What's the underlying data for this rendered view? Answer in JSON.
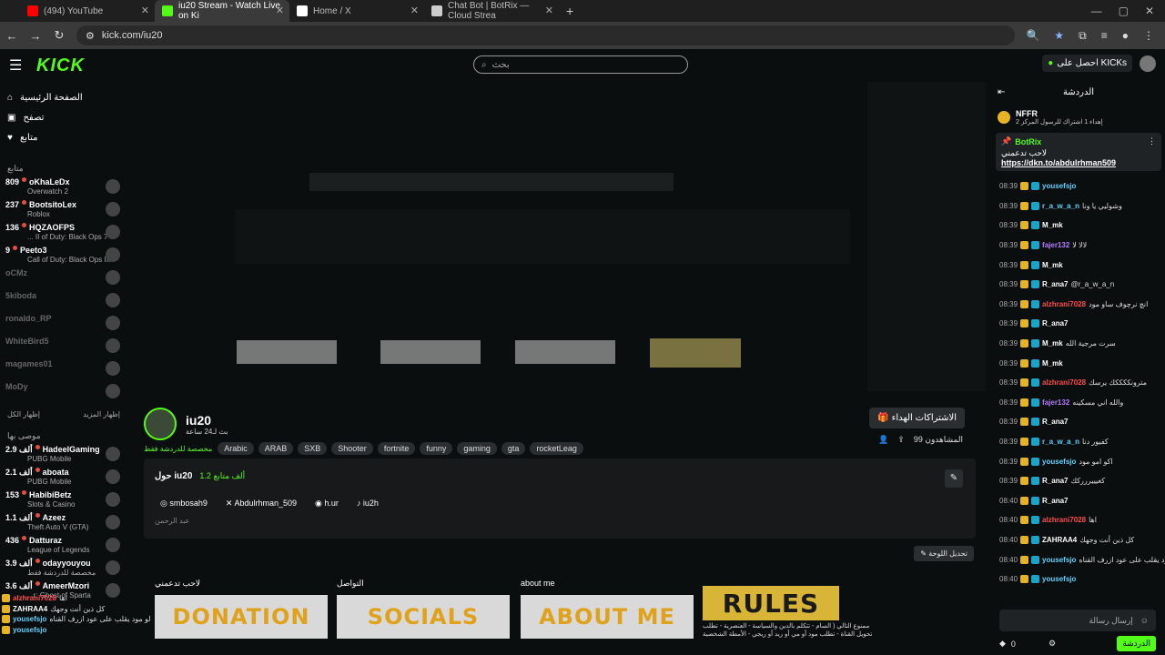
{
  "browser": {
    "tabs": [
      {
        "label": "(494) YouTube",
        "color": "#ff0000"
      },
      {
        "label": "iu20 Stream - Watch Live on Ki",
        "color": "#53fc18"
      },
      {
        "label": "Home / X",
        "color": "#ffffff"
      },
      {
        "label": "Chat Bot | BotRix — Cloud Strea",
        "color": "#cccccc"
      }
    ],
    "url": "kick.com/iu20"
  },
  "header": {
    "logo": "KICK",
    "search_placeholder": "بحث",
    "login_label": "احصل على KICKs"
  },
  "sidebar": {
    "nav": [
      {
        "label": "الصفحة الرئيسية",
        "icon": "home-icon"
      },
      {
        "label": "تصفح",
        "icon": "browse-icon"
      },
      {
        "label": "متابع",
        "icon": "heart-icon"
      }
    ],
    "followed_heading": "متابع",
    "followed": [
      {
        "count": "809",
        "name": "oKhaLeDx",
        "game": "Overwatch 2"
      },
      {
        "count": "237",
        "name": "BootsitoLex",
        "game": "Roblox"
      },
      {
        "count": "136",
        "name": "HQZAOFPS",
        "game": "... II of Duty: Black Ops 7"
      },
      {
        "count": "9",
        "name": "Peeto3",
        "game": "Call of Duty: Black Ops III"
      },
      {
        "count": "",
        "name": "oCMz",
        "game": ""
      },
      {
        "count": "",
        "name": "5kiboda",
        "game": ""
      },
      {
        "count": "",
        "name": "ronaldo_RP",
        "game": ""
      },
      {
        "count": "",
        "name": "WhiteBird5",
        "game": ""
      },
      {
        "count": "",
        "name": "magames01",
        "game": ""
      },
      {
        "count": "",
        "name": "MoDy",
        "game": ""
      }
    ],
    "show_more": "إظهار المزيد",
    "show_all": "إظهار الكل",
    "recommended_heading": "موصى بها",
    "recommended": [
      {
        "count": "2.9 ألف",
        "name": "HadeelGaming",
        "game": "PUBG Mobile"
      },
      {
        "count": "2.1 ألف",
        "name": "aboata",
        "game": "PUBG Mobile"
      },
      {
        "count": "153",
        "name": "HabibiBetz",
        "game": "Slots & Casino"
      },
      {
        "count": "1.1 ألف",
        "name": "Azeez",
        "game": "Theft Auto V (GTA)"
      },
      {
        "count": "436",
        "name": "Datturaz",
        "game": "League of Legends"
      },
      {
        "count": "3.9 ألف",
        "name": "odayyouyou",
        "game": "مخصصة للدردشة فقط"
      },
      {
        "count": "3.6 ألف",
        "name": "AmeerMzori",
        "game": "...r: Ghost of Sparta"
      }
    ]
  },
  "streamer": {
    "name": "iu20",
    "live_info": "بث لـ24 ساعة",
    "category": "مخصصة للدردشة فقط",
    "tags": [
      "Arabic",
      "ARAB",
      "SXB",
      "Shooter",
      "fortnite",
      "funny",
      "gaming",
      "gta",
      "rocketLeag"
    ],
    "subscribe_label": "الاشتراكات الهداء",
    "viewers": "99 المشاهدون"
  },
  "about": {
    "title": "حول iu20",
    "followers": "1.2 ألف متابع",
    "socials": [
      "smbosah9",
      "Abdulrhman_509",
      "h.ur",
      "iu2h"
    ],
    "bio": "عبد الرحمن",
    "edit_panels": "تحديل اللوحة"
  },
  "panels": [
    {
      "label": "لاحب تدعمني",
      "title": "DONATION"
    },
    {
      "label": "التواصل",
      "title": "SOCIALS"
    },
    {
      "label": "about me",
      "title": "ABOUT ME"
    },
    {
      "label": "",
      "title": "RULES"
    }
  ],
  "rules_text": "ممنوع التالي ( السام - تتكلم بالدين والسياسة - العنصرية - تطلب تحويل القناة - تطلب مود أو مي أو ريد أو ريجي - الأمطة الشخصية",
  "chat": {
    "title": "الدردشة",
    "top_gifter": "NFFR",
    "top_gifter_note": "إهداء 1 اشتراك للرسول المركز 2",
    "pinned_user": "BotRix",
    "pinned_text": "لاحب تدعمني",
    "pinned_link": "https://dkn.to/abdulrhman509",
    "messages": [
      {
        "time": "08:39",
        "user": "yousefsjo",
        "color": "#5fd3ff",
        "text": ""
      },
      {
        "time": "08:39",
        "user": "r_a_w_a_n",
        "color": "#5fd3ff",
        "text": "وشوليي يا ونا"
      },
      {
        "time": "08:39",
        "user": "M_mk",
        "color": "#ffffff",
        "text": ""
      },
      {
        "time": "08:39",
        "user": "fajer132",
        "color": "#b57aff",
        "text": "لالا لا"
      },
      {
        "time": "08:39",
        "user": "M_mk",
        "color": "#ffffff",
        "text": ""
      },
      {
        "time": "08:39",
        "user": "R_ana7",
        "color": "#ffffff",
        "text": "@r_a_w_a_n"
      },
      {
        "time": "08:39",
        "user": "alzhrani7028",
        "color": "#ff4b4b",
        "text": "انچ نرچوف ساو مود"
      },
      {
        "time": "08:39",
        "user": "R_ana7",
        "color": "#ffffff",
        "text": ""
      },
      {
        "time": "08:39",
        "user": "M_mk",
        "color": "#ffffff",
        "text": "سرت مرجية الله"
      },
      {
        "time": "08:39",
        "user": "M_mk",
        "color": "#ffffff",
        "text": ""
      },
      {
        "time": "08:39",
        "user": "alzhrani7028",
        "color": "#ff4b4b",
        "text": "مترونككككك يرسك"
      },
      {
        "time": "08:39",
        "user": "fajer132",
        "color": "#b57aff",
        "text": "والله اني مسكينه"
      },
      {
        "time": "08:39",
        "user": "R_ana7",
        "color": "#ffffff",
        "text": ""
      },
      {
        "time": "08:39",
        "user": "r_a_w_a_n",
        "color": "#5fd3ff",
        "text": "كفيور دنا"
      },
      {
        "time": "08:39",
        "user": "yousefsjo",
        "color": "#5fd3ff",
        "text": "اكو امو مود"
      },
      {
        "time": "08:39",
        "user": "R_ana7",
        "color": "#ffffff",
        "text": "كغيييررركك"
      },
      {
        "time": "08:40",
        "user": "R_ana7",
        "color": "#ffffff",
        "text": ""
      },
      {
        "time": "08:40",
        "user": "alzhrani7028",
        "color": "#ff4b4b",
        "text": "اها"
      },
      {
        "time": "08:40",
        "user": "ZAHRAA4",
        "color": "#ffffff",
        "text": "كل ذين أنت وجهك"
      },
      {
        "time": "08:40",
        "user": "yousefsjo",
        "color": "#5fd3ff",
        "text": "لو مود يقلب على عود ازرف القناه"
      },
      {
        "time": "08:40",
        "user": "yousefsjo",
        "color": "#5fd3ff",
        "text": ""
      }
    ],
    "input_placeholder": "إرسال رسالة",
    "points": "0",
    "send_label": "الدردشة"
  },
  "bottom_chat": [
    {
      "user": "alzhrani7028",
      "text": "اها",
      "color": "#ff4b4b"
    },
    {
      "user": "ZAHRAA4",
      "text": "كل ذين أنت وجهك",
      "color": "#ffffff"
    },
    {
      "user": "yousefsjo",
      "text": "لو مود يقلب على عود ازرف القناه",
      "color": "#5fd3ff"
    },
    {
      "user": "yousefsjo",
      "text": "",
      "color": "#5fd3ff"
    }
  ]
}
